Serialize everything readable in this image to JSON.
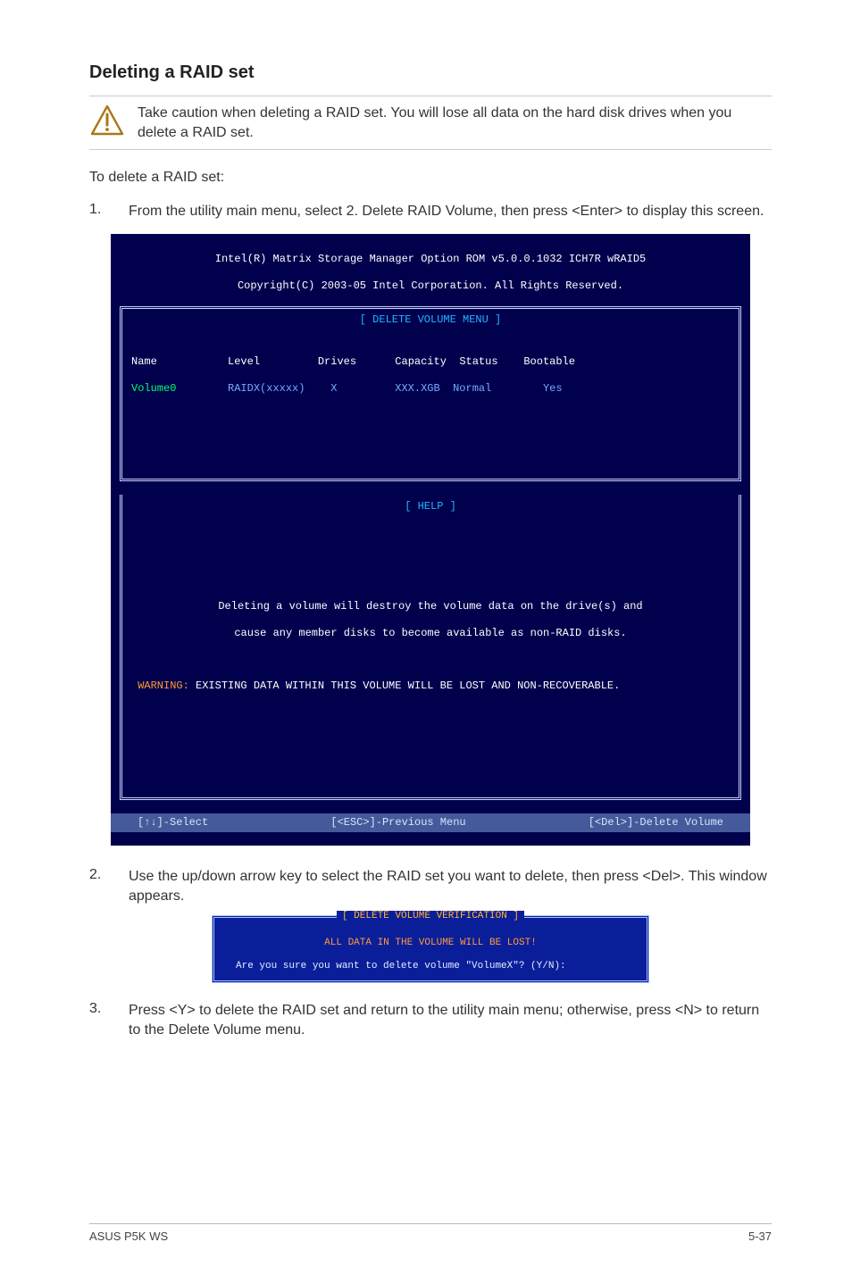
{
  "heading": "Deleting a RAID set",
  "caution": {
    "text": "Take caution when deleting a RAID set. You will lose all data on the hard disk drives when you delete a RAID set."
  },
  "intro": "To delete a RAID set:",
  "steps": {
    "s1": {
      "num": "1.",
      "text": "From the utility main menu, select 2. Delete RAID Volume, then press <Enter> to display this screen."
    },
    "s2": {
      "num": "2.",
      "text": "Use the up/down arrow key to select the RAID set you want to delete, then press <Del>. This window appears."
    },
    "s3": {
      "num": "3.",
      "text": "Press <Y> to delete the RAID set and return to the utility main menu; otherwise, press <N> to return to the Delete Volume menu."
    }
  },
  "bios": {
    "header_line1": "Intel(R) Matrix Storage Manager Option ROM v5.0.0.1032 ICH7R wRAID5",
    "header_line2": "Copyright(C) 2003-05 Intel Corporation. All Rights Reserved.",
    "title": "[ DELETE VOLUME MENU ]",
    "columns": {
      "c1": "Name",
      "c2": "Level",
      "c3": "Drives",
      "c4": "Capacity",
      "c5": "Status",
      "c6": "Bootable"
    },
    "row": {
      "name": "Volume0",
      "level": "RAIDX(xxxxx)",
      "drives": "X",
      "capacity": "XXX.XGB",
      "status": "Normal",
      "bootable": "Yes"
    },
    "help_title": "[ HELP ]",
    "help_line1": "Deleting a volume will destroy the volume data on the drive(s) and",
    "help_line2": "cause any member disks to become available as non-RAID disks.",
    "warn_label": "WARNING:",
    "warn_text": " EXISTING DATA WITHIN THIS VOLUME WILL BE LOST AND NON-RECOVERABLE.",
    "foot": {
      "select": "[↑↓]-Select",
      "prev": "[<ESC>]-Previous Menu",
      "del": "[<Del>]-Delete Volume"
    }
  },
  "confirm": {
    "title": "[ DELETE VOLUME VERIFICATION ]",
    "warn": "ALL DATA IN THE VOLUME WILL BE LOST!",
    "prompt": "Are you sure you want to delete volume \"VolumeX\"? (Y/N):"
  },
  "footer": {
    "left": "ASUS P5K WS",
    "right": "5-37"
  }
}
